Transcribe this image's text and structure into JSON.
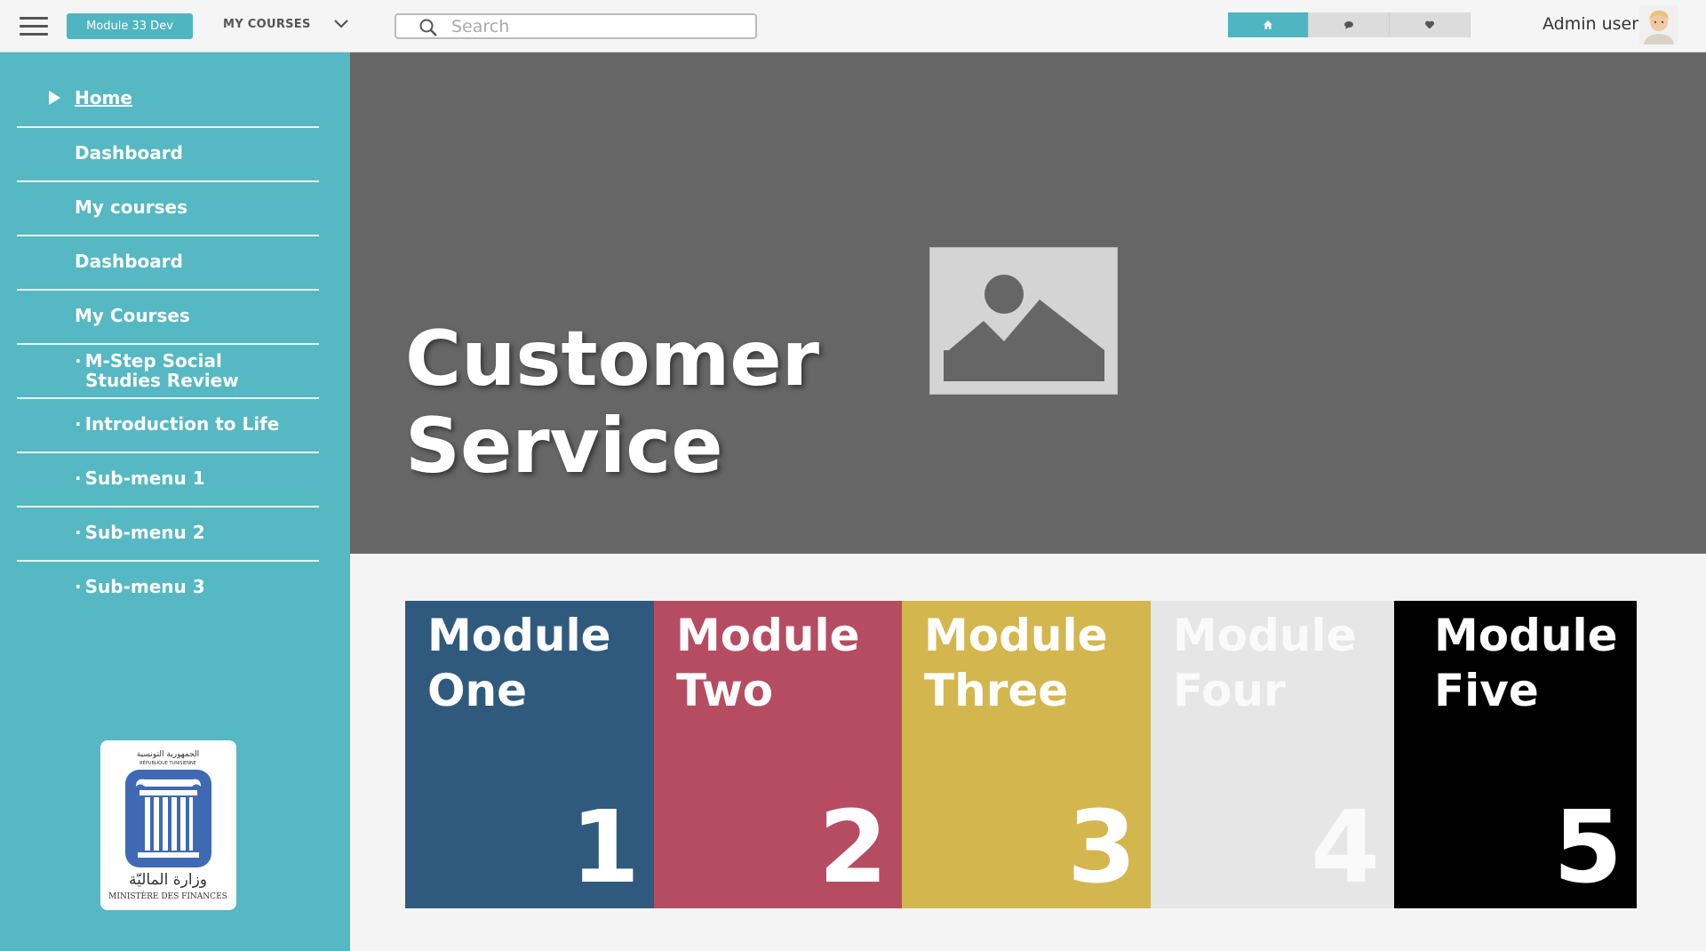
{
  "header": {
    "site_badge": "Module 33 Dev",
    "my_courses_label": "MY COURSES",
    "search_placeholder": "Search",
    "username": "Admin user",
    "nav_tabs": [
      {
        "icon": "home-icon",
        "active": true
      },
      {
        "icon": "chat-icon",
        "active": false
      },
      {
        "icon": "heart-icon",
        "active": false
      }
    ]
  },
  "sidebar": {
    "items": [
      {
        "label": "Home"
      },
      {
        "label": "Dashboard"
      },
      {
        "label": "My courses"
      },
      {
        "label": "Dashboard"
      },
      {
        "label": "My Courses"
      },
      {
        "label_line1": "M-Step Social",
        "label_line2": "Studies Review"
      },
      {
        "label": "Introduction to Life"
      },
      {
        "label": "Sub-menu 1"
      },
      {
        "label": "Sub-menu 2"
      },
      {
        "label": "Sub-menu 3"
      }
    ],
    "logo": {
      "arabic_top": "الجمهورية التونسية",
      "french_top": "RÉPUBLIQUE TUNISIENNE",
      "arabic_bottom": "وزارة الماليّة",
      "french_bottom": "MINISTÈRE DES FINANCES"
    }
  },
  "hero": {
    "title_line1": "Customer",
    "title_line2": "Service"
  },
  "modules": [
    {
      "line1": "Module",
      "line2": "One",
      "number": "1",
      "bg": "#305a7d",
      "text": "#ffffff"
    },
    {
      "line1": "Module",
      "line2": "Two",
      "number": "2",
      "bg": "#b64c62",
      "text": "#ffffff"
    },
    {
      "line1": "Module",
      "line2": "Three",
      "number": "3",
      "bg": "#d4b64e",
      "text": "#ffffff"
    },
    {
      "line1": "Module",
      "line2": "Four",
      "number": "4",
      "bg": "#e6e6e6",
      "text": "#fafafa"
    },
    {
      "line1": "Module",
      "line2": "Five",
      "number": "5",
      "bg": "#000000",
      "text": "#ffffff"
    }
  ],
  "colors": {
    "accent": "#4fb5c0",
    "sidebar": "#55b8c3",
    "hero_bg": "#666666"
  }
}
